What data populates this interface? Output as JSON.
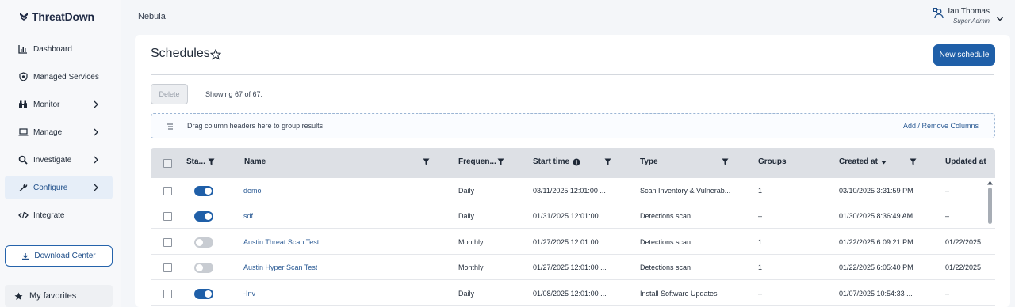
{
  "app": {
    "brand": "ThreatDown",
    "breadcrumb": "Nebula"
  },
  "user": {
    "name": "Ian Thomas",
    "role": "Super Admin"
  },
  "sidebar": {
    "items": [
      {
        "label": "Dashboard",
        "icon": "bar-chart-icon"
      },
      {
        "label": "Managed Services",
        "icon": "shield-icon"
      },
      {
        "label": "Monitor",
        "icon": "binoculars-icon"
      },
      {
        "label": "Manage",
        "icon": "laptop-icon"
      },
      {
        "label": "Investigate",
        "icon": "search-icon"
      },
      {
        "label": "Configure",
        "icon": "wrench-icon",
        "active": true
      },
      {
        "label": "Integrate",
        "icon": "code-icon"
      }
    ],
    "download_label": "Download Center",
    "favorites_label": "My favorites"
  },
  "page": {
    "title": "Schedules",
    "new_button": "New schedule",
    "delete_button": "Delete",
    "showing": "Showing 67 of 67.",
    "group_hint": "Drag column headers here to group results",
    "columns_link": "Add / Remove Columns"
  },
  "table": {
    "headers": {
      "status": "Sta...",
      "name": "Name",
      "frequency": "Frequen...",
      "start_time": "Start time",
      "type": "Type",
      "groups": "Groups",
      "created_at": "Created at",
      "updated_at": "Updated at"
    },
    "rows": [
      {
        "enabled": true,
        "name": "demo",
        "frequency": "Daily",
        "start_time": "03/11/2025 12:01:00 ...",
        "type": "Scan Inventory & Vulnerab...",
        "groups": "1",
        "created_at": "03/10/2025 3:31:59 PM",
        "updated_at": "–"
      },
      {
        "enabled": true,
        "name": "sdf",
        "frequency": "Daily",
        "start_time": "01/31/2025 12:01:00 ...",
        "type": "Detections scan",
        "groups": "–",
        "created_at": "01/30/2025 8:36:49 AM",
        "updated_at": "–"
      },
      {
        "enabled": false,
        "name": "Austin Threat Scan Test",
        "frequency": "Monthly",
        "start_time": "01/27/2025 12:01:00 ...",
        "type": "Detections scan",
        "groups": "1",
        "created_at": "01/22/2025 6:09:21 PM",
        "updated_at": "01/22/2025"
      },
      {
        "enabled": false,
        "name": "Austin Hyper Scan Test",
        "frequency": "Monthly",
        "start_time": "01/27/2025 12:01:00 ...",
        "type": "Detections scan",
        "groups": "1",
        "created_at": "01/22/2025 6:05:40 PM",
        "updated_at": "01/22/2025"
      },
      {
        "enabled": true,
        "name": "-Inv",
        "frequency": "Daily",
        "start_time": "01/08/2025 12:01:00 ...",
        "type": "Install Software Updates",
        "groups": "–",
        "created_at": "01/07/2025 10:54:33 ...",
        "updated_at": "–"
      }
    ]
  },
  "colors": {
    "accent": "#1f5fa8",
    "link": "#2a5a94",
    "header_bg": "#dde0e5",
    "toggle_off": "#c8ccd2"
  }
}
